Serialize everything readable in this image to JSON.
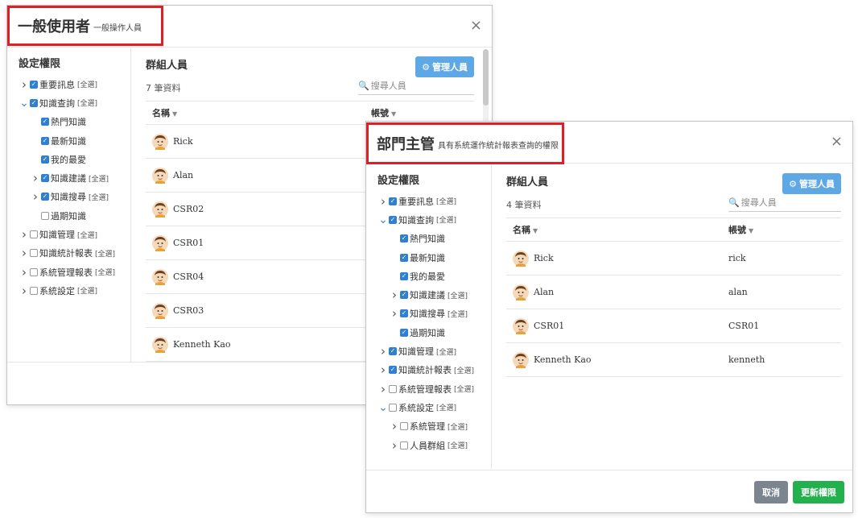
{
  "modal_a": {
    "title": "一般使用者",
    "subtitle": "一般操作人員",
    "close": "×",
    "panel_title": "設定權限",
    "tree": [
      {
        "label": "重要訊息",
        "all": "[全選]",
        "arrow": "right",
        "checked": true,
        "level": 0
      },
      {
        "label": "知識查詢",
        "all": "[全選]",
        "arrow": "down",
        "checked": true,
        "level": 0
      },
      {
        "label": "熱門知識",
        "all": "",
        "arrow": "none",
        "checked": true,
        "level": 1
      },
      {
        "label": "最新知識",
        "all": "",
        "arrow": "none",
        "checked": true,
        "level": 1
      },
      {
        "label": "我的最愛",
        "all": "",
        "arrow": "none",
        "checked": true,
        "level": 1
      },
      {
        "label": "知識建議",
        "all": "[全選]",
        "arrow": "right",
        "checked": true,
        "level": 1
      },
      {
        "label": "知識搜尋",
        "all": "[全選]",
        "arrow": "right",
        "checked": true,
        "level": 1
      },
      {
        "label": "過期知識",
        "all": "",
        "arrow": "none",
        "checked": false,
        "level": 1
      },
      {
        "label": "知識管理",
        "all": "[全選]",
        "arrow": "right",
        "checked": false,
        "level": 0
      },
      {
        "label": "知識統計報表",
        "all": "[全選]",
        "arrow": "right",
        "checked": false,
        "level": 0
      },
      {
        "label": "系統管理報表",
        "all": "[全選]",
        "arrow": "right",
        "checked": false,
        "level": 0
      },
      {
        "label": "系統設定",
        "all": "[全選]",
        "arrow": "right",
        "checked": false,
        "level": 0
      }
    ],
    "group_title": "群組人員",
    "manage_label": "管理人員",
    "count": "7 筆資料",
    "search_placeholder": "搜尋人員",
    "col_name": "名稱",
    "col_account": "帳號",
    "members": [
      {
        "name": "Rick",
        "account": ""
      },
      {
        "name": "Alan",
        "account": ""
      },
      {
        "name": "CSR02",
        "account": ""
      },
      {
        "name": "CSR01",
        "account": ""
      },
      {
        "name": "CSR04",
        "account": ""
      },
      {
        "name": "CSR03",
        "account": ""
      },
      {
        "name": "Kenneth Kao",
        "account": ""
      }
    ]
  },
  "modal_b": {
    "title": "部門主管",
    "subtitle": "具有系統運作統計報表查詢的權限",
    "close": "×",
    "panel_title": "設定權限",
    "tree": [
      {
        "label": "重要訊息",
        "all": "[全選]",
        "arrow": "right",
        "checked": true,
        "level": 0
      },
      {
        "label": "知識查詢",
        "all": "[全選]",
        "arrow": "down",
        "checked": true,
        "level": 0
      },
      {
        "label": "熱門知識",
        "all": "",
        "arrow": "none",
        "checked": true,
        "level": 1
      },
      {
        "label": "最新知識",
        "all": "",
        "arrow": "none",
        "checked": true,
        "level": 1
      },
      {
        "label": "我的最愛",
        "all": "",
        "arrow": "none",
        "checked": true,
        "level": 1
      },
      {
        "label": "知識建議",
        "all": "[全選]",
        "arrow": "right",
        "checked": true,
        "level": 1
      },
      {
        "label": "知識搜尋",
        "all": "[全選]",
        "arrow": "right",
        "checked": true,
        "level": 1
      },
      {
        "label": "過期知識",
        "all": "",
        "arrow": "none",
        "checked": true,
        "level": 1
      },
      {
        "label": "知識管理",
        "all": "[全選]",
        "arrow": "right",
        "checked": true,
        "level": 0
      },
      {
        "label": "知識統計報表",
        "all": "[全選]",
        "arrow": "right",
        "checked": true,
        "level": 0
      },
      {
        "label": "系統管理報表",
        "all": "[全選]",
        "arrow": "right",
        "checked": false,
        "level": 0
      },
      {
        "label": "系統設定",
        "all": "[全選]",
        "arrow": "down",
        "checked": false,
        "level": 0
      },
      {
        "label": "系統管理",
        "all": "[全選]",
        "arrow": "right",
        "checked": false,
        "level": 1
      },
      {
        "label": "人員群組",
        "all": "[全選]",
        "arrow": "right",
        "checked": false,
        "level": 1
      }
    ],
    "group_title": "群組人員",
    "manage_label": "管理人員",
    "count": "4 筆資料",
    "search_placeholder": "搜尋人員",
    "col_name": "名稱",
    "col_account": "帳號",
    "members": [
      {
        "name": "Rick",
        "account": "rick"
      },
      {
        "name": "Alan",
        "account": "alan"
      },
      {
        "name": "CSR01",
        "account": "CSR01"
      },
      {
        "name": "Kenneth Kao",
        "account": "kenneth"
      }
    ],
    "cancel_label": "取消",
    "update_label": "更新權限"
  },
  "colors": {
    "highlight_border": "#dd1f26",
    "checkbox_blue": "#2f7fd4",
    "manage_button": "#5fa8e6",
    "update_button": "#23b14d",
    "cancel_button": "#7a8590"
  }
}
